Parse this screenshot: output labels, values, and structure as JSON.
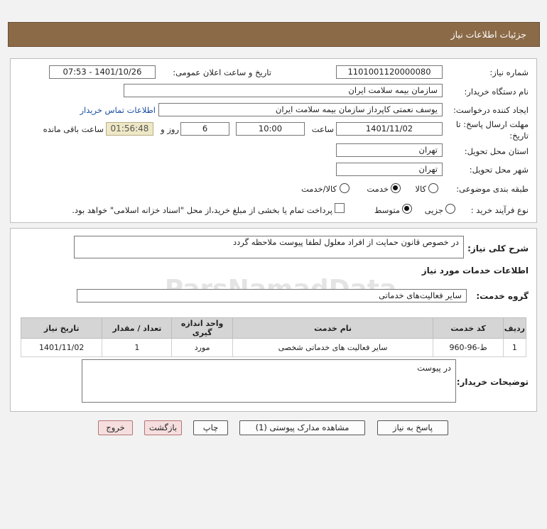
{
  "header": {
    "title": "جزئیات اطلاعات نیاز"
  },
  "form": {
    "need_number_label": "شماره نیاز:",
    "need_number": "1101001120000080",
    "announce_label": "تاریخ و ساعت اعلان عمومی:",
    "announce_value": "1401/10/26 - 07:53",
    "buyer_org_label": "نام دستگاه خریدار:",
    "buyer_org": "سازمان بیمه سلامت ایران",
    "creator_label": "ایجاد کننده درخواست:",
    "creator": "یوسف نعمتی کاپرداز سازمان بیمه سلامت ایران",
    "contact_link": "اطلاعات تماس خریدار",
    "deadline_label_1": "مهلت ارسال پاسخ: تا",
    "deadline_label_2": "تاریخ:",
    "deadline_date": "1401/11/02",
    "time_label": "ساعت",
    "deadline_time": "10:00",
    "days_value": "6",
    "days_label": "روز و",
    "remaining_time": "01:56:48",
    "remaining_label": "ساعت باقی مانده",
    "province_label": "استان محل تحویل:",
    "province": "تهران",
    "city_label": "شهر محل تحویل:",
    "city": "تهران",
    "category_label": "طبقه بندی موضوعی:",
    "category_options": [
      "کالا",
      "خدمت",
      "کالا/خدمت"
    ],
    "category_selected": "خدمت",
    "process_label": "نوع فرآیند خرید :",
    "process_options": [
      "جزیی",
      "متوسط"
    ],
    "process_selected": "متوسط",
    "payment_note": "پرداخت تمام یا بخشی از مبلغ خرید،از محل \"اسناد خزانه اسلامی\" خواهد بود."
  },
  "summary": {
    "label": "شرح کلی نیاز:",
    "text": "در خصوص قانون حمایت از افراد معلول لطفا پیوست ملاحظه گردد",
    "services_title": "اطلاعات خدمات مورد نیاز",
    "service_group_label": "گروه خدمت:",
    "service_group": "سایر فعالیت‌های خدماتی"
  },
  "table": {
    "headers": [
      "ردیف",
      "کد خدمت",
      "نام خدمت",
      "واحد اندازه گیری",
      "تعداد / مقدار",
      "تاریخ نیاز"
    ],
    "rows": [
      [
        "1",
        "ط-96-960",
        "سایر فعالیت های خدماتی شخصی",
        "مورد",
        "1",
        "1401/11/02"
      ]
    ]
  },
  "buyer_notes": {
    "label": "توضیحات خریدار:",
    "text": "در پیوست"
  },
  "buttons": {
    "reply": "پاسخ به نیاز",
    "attachments": "مشاهده مدارک پیوستی (1)",
    "print": "چاپ",
    "back": "بازگشت",
    "exit": "خروج"
  },
  "colors": {
    "header_bg": "#8b6a47",
    "timer_bg": "#efe8c6",
    "link": "#1a4fa0"
  }
}
